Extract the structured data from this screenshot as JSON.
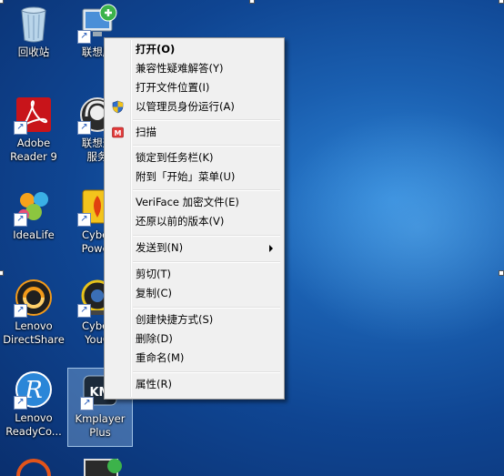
{
  "desktop": {
    "icons": [
      {
        "label": "回收站"
      },
      {
        "label": "联想服"
      },
      {
        "label": "Adobe\nReader 9"
      },
      {
        "label": "联想通\n服务"
      },
      {
        "label": "IdeaLife"
      },
      {
        "label": "Cyber\nPower"
      },
      {
        "label": "Lenovo\nDirectShare"
      },
      {
        "label": "Cyber\nYouC"
      },
      {
        "label": "Lenovo\nReadyCo..."
      },
      {
        "label": "Kmplayer\nPlus"
      }
    ]
  },
  "context_menu": {
    "items": [
      {
        "label": "打开(O)",
        "bold": true
      },
      {
        "label": "兼容性疑难解答(Y)"
      },
      {
        "label": "打开文件位置(I)"
      },
      {
        "label": "以管理员身份运行(A)",
        "icon": "uac-shield-icon"
      },
      {
        "label": "扫描",
        "icon": "scan-m-icon"
      },
      {
        "label": "锁定到任务栏(K)"
      },
      {
        "label": "附到「开始」菜单(U)"
      },
      {
        "label": "VeriFace 加密文件(E)"
      },
      {
        "label": "还原以前的版本(V)"
      },
      {
        "label": "发送到(N)",
        "submenu": true
      },
      {
        "label": "剪切(T)"
      },
      {
        "label": "复制(C)"
      },
      {
        "label": "创建快捷方式(S)"
      },
      {
        "label": "删除(D)"
      },
      {
        "label": "重命名(M)"
      },
      {
        "label": "属性(R)"
      }
    ]
  },
  "colors": {
    "menu_bg": "#f0f0f0",
    "menu_border": "#979797",
    "desktop_blue": "#1a5fb0"
  }
}
